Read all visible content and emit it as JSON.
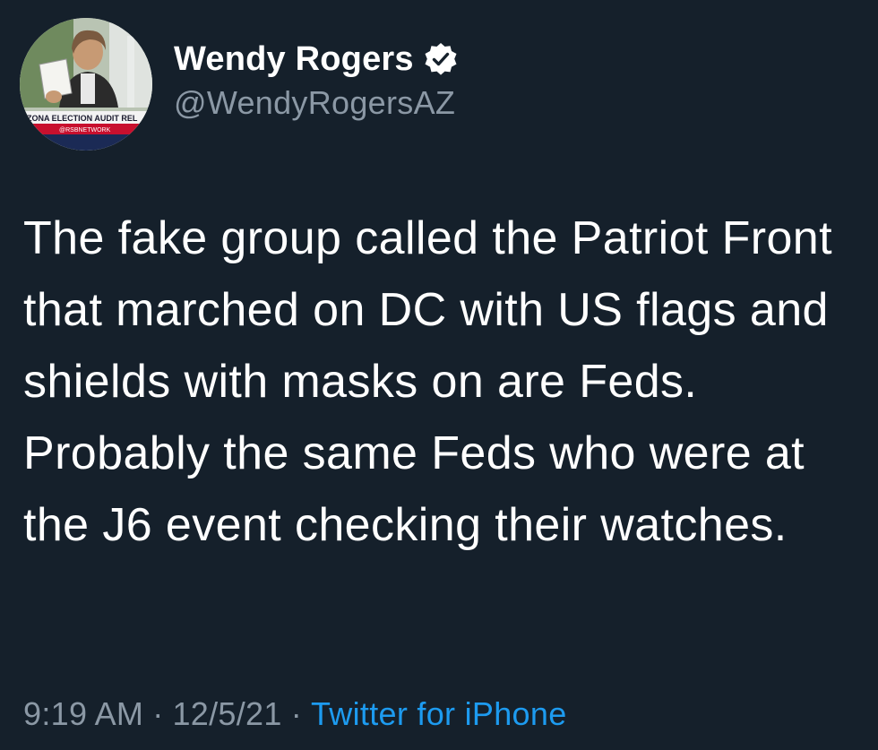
{
  "tweet": {
    "author": {
      "display_name": "Wendy Rogers",
      "handle": "@WendyRogersAZ",
      "verified": true,
      "avatar_banner_text": "ZONA ELECTION AUDIT REL",
      "avatar_banner_subtext": "@RSBNETWORK"
    },
    "text": "The fake group called the Patriot Front that marched on DC with US flags and shields with masks on are Feds. Probably the same Feds who were at the J6 event checking their watches.",
    "time": "9:19 AM",
    "date": "12/5/21",
    "separator": "·",
    "source": "Twitter for iPhone"
  },
  "colors": {
    "background": "#15202b",
    "text_primary": "#ffffff",
    "text_secondary": "#8b98a5",
    "link": "#1d9bf0"
  },
  "icons": {
    "verified": "verified-badge-icon"
  }
}
